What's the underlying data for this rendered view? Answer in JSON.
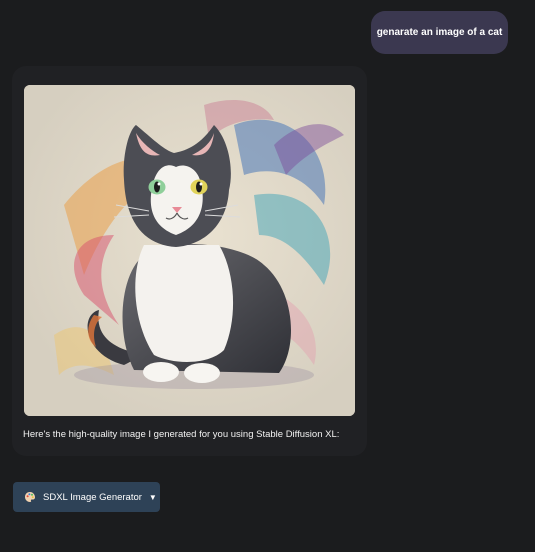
{
  "conversation": {
    "user_message": "genarate an image of a cat",
    "assistant_caption": "Here's the high-quality image I generated for you using Stable Diffusion XL:"
  },
  "image": {
    "subject": "cat-illustration"
  },
  "tool": {
    "label": "SDXL Image Generator",
    "icon": "palette-icon",
    "dropdown_icon": "triangle-down-icon"
  },
  "colors": {
    "background": "#1b1c1e",
    "user_bubble": "#3b3850",
    "assistant_card": "#202124",
    "tool_button": "#2e4257"
  }
}
